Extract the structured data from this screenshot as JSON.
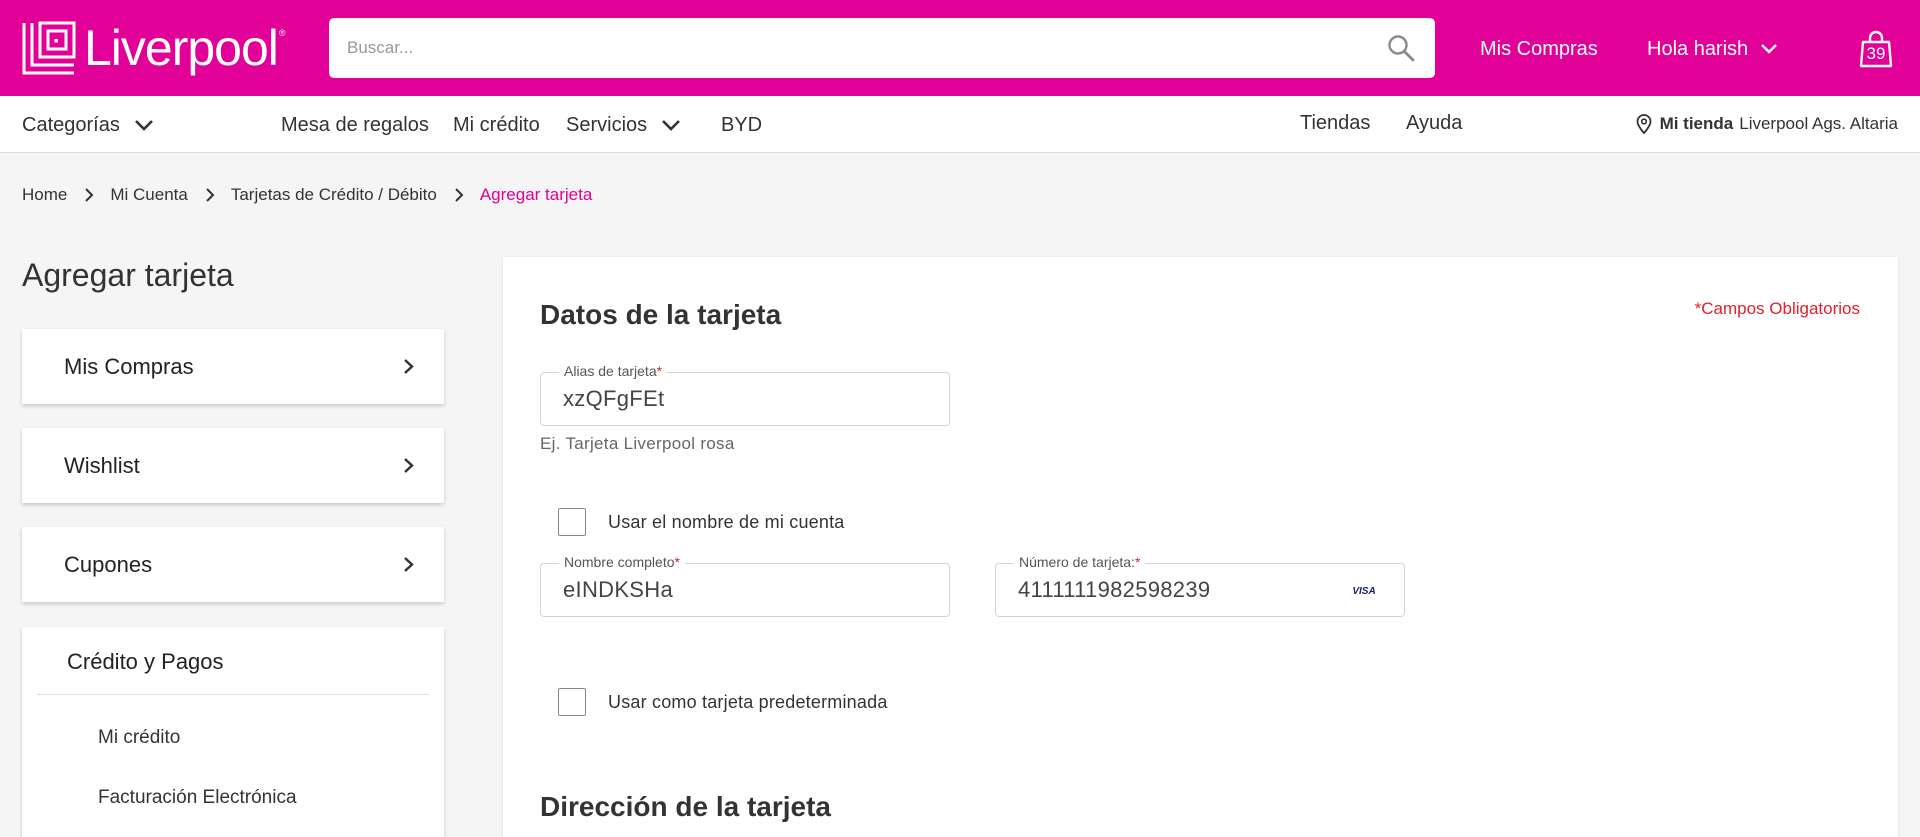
{
  "header": {
    "logo_text": "Liverpool",
    "search_placeholder": "Buscar...",
    "mis_compras": "Mis Compras",
    "greeting": "Hola harish",
    "bag_count": "39",
    "brand_color": "#e10098"
  },
  "nav": {
    "categorias": "Categorías",
    "mesa": "Mesa de regalos",
    "credito": "Mi crédito",
    "servicios": "Servicios",
    "byd": "BYD",
    "tiendas": "Tiendas",
    "ayuda": "Ayuda",
    "store_label": "Mi tienda",
    "store_name": "Liverpool Ags. Altaria"
  },
  "breadcrumb": {
    "items": [
      "Home",
      "Mi Cuenta",
      "Tarjetas de Crédito / Débito"
    ],
    "current": "Agregar tarjeta"
  },
  "sidebar": {
    "title": "Agregar tarjeta",
    "cards": [
      "Mis Compras",
      "Wishlist",
      "Cupones"
    ],
    "group_title": "Crédito y Pagos",
    "group_items": [
      "Mi crédito",
      "Facturación Electrónica"
    ]
  },
  "form": {
    "section_title": "Datos de la tarjeta",
    "required_note": "*Campos Obligatorios",
    "alias_label": "Alias de tarjeta",
    "alias_value": "xzQFgFEt",
    "alias_hint": "Ej. Tarjeta Liverpool rosa",
    "use_account_name": "Usar el nombre de mi cuenta",
    "name_label": "Nombre completo",
    "name_value": "eINDKSHa",
    "number_label": "Número de tarjeta:",
    "number_value": "4111111982598239",
    "card_brand": "VISA",
    "default_card": "Usar como tarjeta predeterminada",
    "address_title": "Dirección de la tarjeta",
    "required_mark": "*"
  }
}
